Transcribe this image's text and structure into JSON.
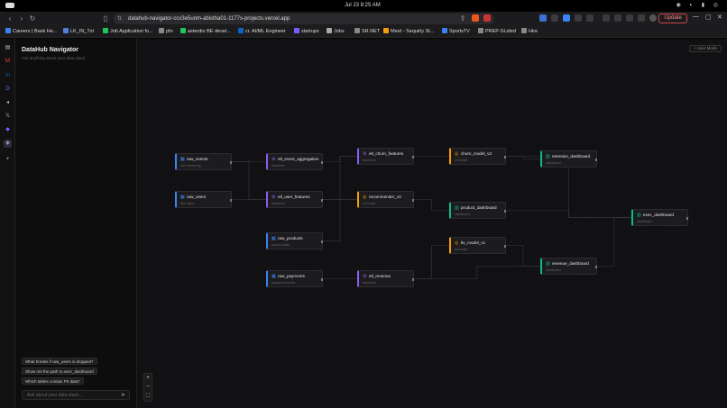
{
  "os": {
    "clock": "Jul 23   8:25 AM"
  },
  "browser": {
    "url": "datahub-navigator-ccv3e5unm-abistha01-1177s-projects.vercel.app",
    "update_label": "Update"
  },
  "bookmarks": [
    {
      "label": "Careers | Bask He...",
      "color": "#3b82f6"
    },
    {
      "label": "LK_IN_Txt",
      "color": "#4f7fd9"
    },
    {
      "label": "Job Application fo...",
      "color": "#22c55e"
    },
    {
      "label": "pfo",
      "color": "#888888"
    },
    {
      "label": "asterdio BE devel...",
      "color": "#22c55e"
    },
    {
      "label": "cr. AI/ML Engineer",
      "color": "#0a66c2"
    },
    {
      "label": "startups",
      "color": "#7c5cff"
    },
    {
      "label": "Jobs",
      "color": "#aaaaaa"
    },
    {
      "label": "SR.NET",
      "color": "#888888"
    },
    {
      "label": "Meet - Sequirly St...",
      "color": "#f59e0b"
    },
    {
      "label": "SportsTV",
      "color": "#3b82f6"
    },
    {
      "label": "PREP-SLided",
      "color": "#888888"
    },
    {
      "label": "Hire",
      "color": "#888888"
    }
  ],
  "panel": {
    "title": "DataHub Navigator",
    "subtitle": "Ask anything about your data stack",
    "suggestions": [
      "What breaks if raw_users is dropped?",
      "Show me the path to exec_dashboard",
      "Which tables contain PII data?"
    ],
    "input_placeholder": "Ask about your data stack..."
  },
  "canvas": {
    "user_mode_label": "+ User Mode"
  },
  "nodes": [
    {
      "id": "raw_events",
      "label": "raw_events",
      "meta": "raw events log",
      "kind": "table",
      "accent": "#3b82f6"
    },
    {
      "id": "raw_users",
      "label": "raw_users",
      "meta": "raw users",
      "kind": "table",
      "accent": "#3b82f6"
    },
    {
      "id": "etl_event_aggregation",
      "label": "etl_event_aggregation",
      "meta": "transform",
      "kind": "etl",
      "accent": "#8b5cf6"
    },
    {
      "id": "etl_user_features",
      "label": "etl_user_features",
      "meta": "transform",
      "kind": "etl",
      "accent": "#8b5cf6"
    },
    {
      "id": "raw_products",
      "label": "raw_products",
      "meta": "product table",
      "kind": "table",
      "accent": "#3b82f6"
    },
    {
      "id": "raw_payments",
      "label": "raw_payments",
      "meta": "payment records",
      "kind": "table",
      "accent": "#3b82f6"
    },
    {
      "id": "etl_churn_features",
      "label": "etl_churn_features",
      "meta": "transform",
      "kind": "etl",
      "accent": "#8b5cf6"
    },
    {
      "id": "recommender_v2",
      "label": "recommender_v2",
      "meta": "ml model",
      "kind": "model",
      "accent": "#f59e0b"
    },
    {
      "id": "etl_revenue",
      "label": "etl_revenue",
      "meta": "transform",
      "kind": "etl",
      "accent": "#8b5cf6"
    },
    {
      "id": "churn_model_v3",
      "label": "churn_model_v3",
      "meta": "ml model",
      "kind": "model",
      "accent": "#f59e0b"
    },
    {
      "id": "product_dashboard",
      "label": "product_dashboard",
      "meta": "dashboard",
      "kind": "dashboard",
      "accent": "#10b981"
    },
    {
      "id": "ltv_model_v1",
      "label": "ltv_model_v1",
      "meta": "ml model",
      "kind": "model",
      "accent": "#f59e0b"
    },
    {
      "id": "retention_dashboard",
      "label": "retention_dashboard",
      "meta": "dashboard",
      "kind": "dashboard",
      "accent": "#10b981"
    },
    {
      "id": "revenue_dashboard",
      "label": "revenue_dashboard",
      "meta": "dashboard",
      "kind": "dashboard",
      "accent": "#10b981"
    },
    {
      "id": "exec_dashboard",
      "label": "exec_dashboard",
      "meta": "dashboard",
      "kind": "dashboard",
      "accent": "#10b981"
    }
  ],
  "edges": [
    [
      "raw_events",
      "etl_event_aggregation"
    ],
    [
      "raw_users",
      "etl_user_features"
    ],
    [
      "raw_events",
      "etl_user_features"
    ],
    [
      "etl_event_aggregation",
      "etl_churn_features"
    ],
    [
      "etl_user_features",
      "etl_churn_features"
    ],
    [
      "etl_user_features",
      "recommender_v2"
    ],
    [
      "raw_products",
      "recommender_v2"
    ],
    [
      "raw_payments",
      "etl_revenue"
    ],
    [
      "etl_churn_features",
      "churn_model_v3"
    ],
    [
      "recommender_v2",
      "product_dashboard"
    ],
    [
      "etl_revenue",
      "ltv_model_v1"
    ],
    [
      "etl_revenue",
      "revenue_dashboard"
    ],
    [
      "churn_model_v3",
      "retention_dashboard"
    ],
    [
      "churn_model_v3",
      "exec_dashboard"
    ],
    [
      "product_dashboard",
      "exec_dashboard"
    ],
    [
      "ltv_model_v1",
      "revenue_dashboard"
    ],
    [
      "revenue_dashboard",
      "exec_dashboard"
    ]
  ],
  "icons": {
    "table": "table-icon",
    "etl": "gear-icon",
    "model": "model-icon",
    "dashboard": "chart-icon"
  }
}
